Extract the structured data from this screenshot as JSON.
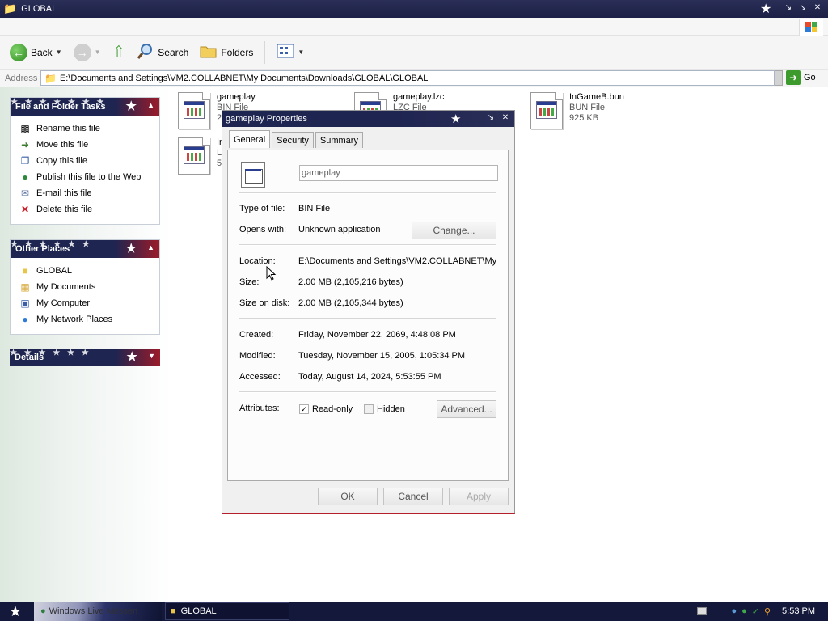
{
  "window": {
    "title": "GLOBAL"
  },
  "toolbar": {
    "back": "Back",
    "search": "Search",
    "folders": "Folders"
  },
  "address": {
    "label": "Address",
    "path": "E:\\Documents and Settings\\VM2.COLLABNET\\My Documents\\Downloads\\GLOBAL\\GLOBAL",
    "go": "Go"
  },
  "panels": {
    "tasks": {
      "title": "File and Folder Tasks",
      "items": [
        {
          "label": "Rename this file",
          "icon": "rename-icon"
        },
        {
          "label": "Move this file",
          "icon": "move-icon"
        },
        {
          "label": "Copy this file",
          "icon": "copy-icon"
        },
        {
          "label": "Publish this file to the Web",
          "icon": "globe-icon"
        },
        {
          "label": "E-mail this file",
          "icon": "email-icon"
        },
        {
          "label": "Delete this file",
          "icon": "delete-icon"
        }
      ]
    },
    "places": {
      "title": "Other Places",
      "items": [
        {
          "label": "GLOBAL",
          "icon": "folder-icon"
        },
        {
          "label": "My Documents",
          "icon": "documents-icon"
        },
        {
          "label": "My Computer",
          "icon": "computer-icon"
        },
        {
          "label": "My Network Places",
          "icon": "network-icon"
        }
      ]
    },
    "details": {
      "title": "Details"
    }
  },
  "files": [
    {
      "name": "gameplay",
      "type": "BIN File",
      "size": "2"
    },
    {
      "name": "gameplay.lzc",
      "type": "LZC File",
      "size": ""
    },
    {
      "name": "InGameB.bun",
      "type": "BUN File",
      "size": "925 KB"
    },
    {
      "name": "In",
      "type": "LZ",
      "size": "5"
    }
  ],
  "dialog": {
    "title": "gameplay Properties",
    "tabs": [
      "General",
      "Security",
      "Summary"
    ],
    "filename": "gameplay",
    "type_label": "Type of file:",
    "type_value": "BIN File",
    "opens_label": "Opens with:",
    "opens_value": "Unknown application",
    "change_button": "Change...",
    "location_label": "Location:",
    "location_value": "E:\\Documents and Settings\\VM2.COLLABNET\\My",
    "size_label": "Size:",
    "size_value": "2.00 MB (2,105,216 bytes)",
    "sizeondisk_label": "Size on disk:",
    "sizeondisk_value": "2.00 MB (2,105,344 bytes)",
    "created_label": "Created:",
    "created_value": "Friday, November 22, 2069, 4:48:08 PM",
    "modified_label": "Modified:",
    "modified_value": "Tuesday, November 15, 2005, 1:05:34 PM",
    "accessed_label": "Accessed:",
    "accessed_value": "Today, August 14, 2024, 5:53:55 PM",
    "attributes_label": "Attributes:",
    "readonly_label": "Read-only",
    "readonly_checked": true,
    "hidden_label": "Hidden",
    "hidden_checked": false,
    "advanced_button": "Advanced...",
    "ok_button": "OK",
    "cancel_button": "Cancel",
    "apply_button": "Apply"
  },
  "taskbar": {
    "messenger": "Windows Live Messen",
    "window_tab": "GLOBAL",
    "clock": "5:53 PM"
  }
}
